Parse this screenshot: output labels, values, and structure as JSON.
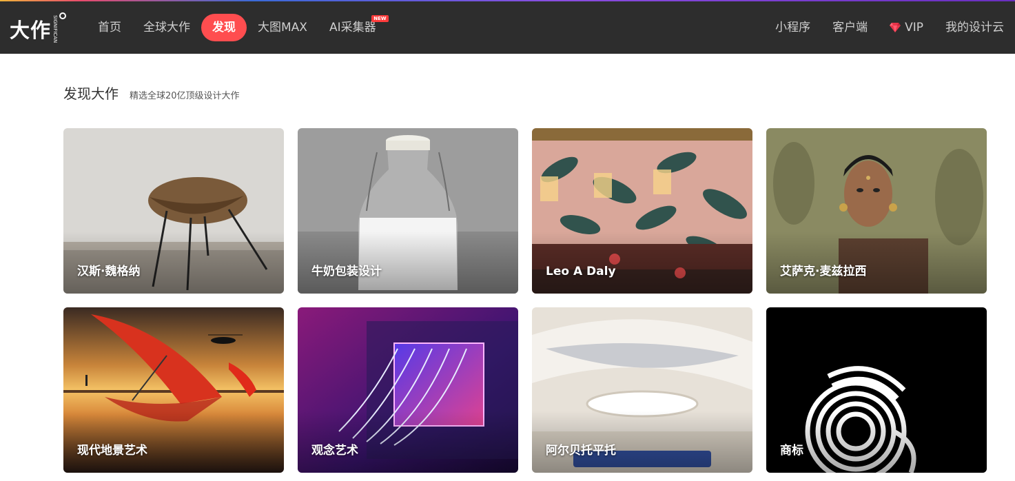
{
  "header": {
    "logo_text": "大作",
    "logo_sub": "SIGNIFICAN",
    "nav": [
      {
        "label": "首页",
        "active": false
      },
      {
        "label": "全球大作",
        "active": false
      },
      {
        "label": "发现",
        "active": true
      },
      {
        "label": "大图MAX",
        "active": false
      },
      {
        "label": "AI采集器",
        "active": false,
        "badge": "NEW"
      }
    ],
    "right_nav": [
      {
        "label": "小程序"
      },
      {
        "label": "客户端"
      },
      {
        "label": "VIP",
        "icon": "diamond-icon"
      },
      {
        "label": "我的设计云"
      }
    ]
  },
  "section": {
    "title": "发现大作",
    "subtitle": "精选全球20亿顶级设计大作"
  },
  "cards": [
    {
      "caption": "汉斯·魏格纳",
      "image": "leather-chair"
    },
    {
      "caption": "牛奶包装设计",
      "image": "milk-bottle"
    },
    {
      "caption": "Leo A Daly",
      "image": "tropical-interior"
    },
    {
      "caption": "艾萨克·麦兹拉西",
      "image": "portrait-woman"
    },
    {
      "caption": "现代地景艺术",
      "image": "red-umbrella-sunset"
    },
    {
      "caption": "观念艺术",
      "image": "neon-curtain"
    },
    {
      "caption": "阿尔贝托平托",
      "image": "white-interior"
    },
    {
      "caption": "商标",
      "image": "wool-mark-logo"
    }
  ],
  "colors": {
    "header_bg": "#2d2d2d",
    "accent": "#ff4d4f"
  }
}
